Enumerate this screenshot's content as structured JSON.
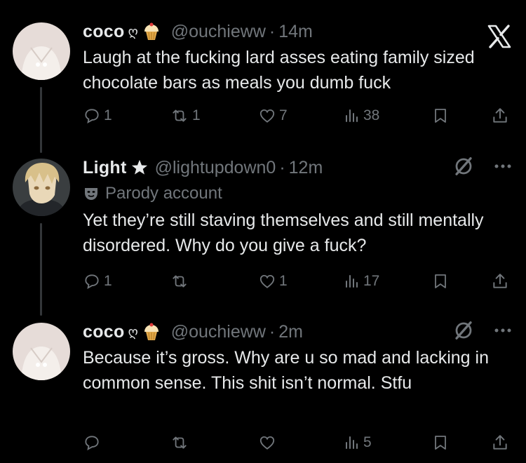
{
  "tweets": [
    {
      "name": "coco",
      "deco": "ღ",
      "handle": "@ouchieww",
      "sep": "·",
      "time": "14m",
      "text": "Laugh at the fucking lard asses eating family sized chocolate bars as meals you dumb fuck",
      "replies": "1",
      "reposts": "1",
      "likes": "7",
      "views": "38"
    },
    {
      "name": "Light",
      "handle": "@lightupdown0",
      "sep": "·",
      "time": "12m",
      "parody": "Parody account",
      "text": "Yet they’re still staving themselves and still mentally disordered. Why do you give a fuck?",
      "replies": "1",
      "reposts": "",
      "likes": "1",
      "views": "17"
    },
    {
      "name": "coco",
      "deco": "ღ",
      "handle": "@ouchieww",
      "sep": "·",
      "time": "2m",
      "text": "Because it’s gross. Why are u so mad and lacking in common sense. This shit isn’t normal. Stfu",
      "replies": "",
      "reposts": "",
      "likes": "",
      "views": "5"
    }
  ],
  "icons": [
    "x-logo-icon",
    "grok-icon",
    "more-icon",
    "reply-icon",
    "repost-icon",
    "like-icon",
    "views-icon",
    "bookmark-icon",
    "share-icon",
    "theater-mask-icon",
    "star-icon",
    "cupcake-icon"
  ],
  "colors": {
    "background": "#000000",
    "text": "#e7e9ea",
    "muted": "#71767b",
    "line": "#333639"
  }
}
